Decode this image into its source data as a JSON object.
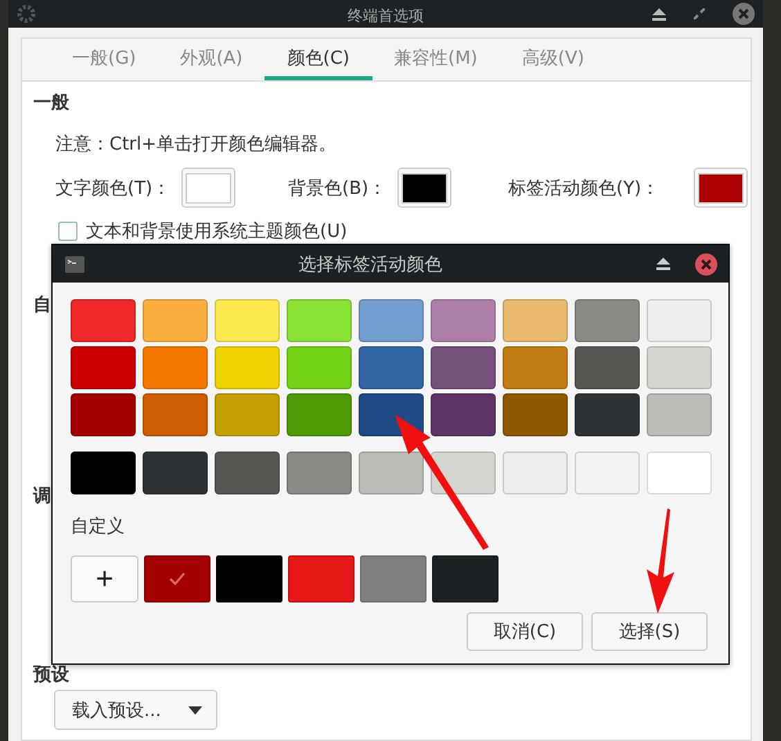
{
  "window": {
    "title": "终端首选项"
  },
  "tabs": [
    {
      "label": "一般(G)",
      "selected": false
    },
    {
      "label": "外观(A)",
      "selected": false
    },
    {
      "label": "颜色(C)",
      "selected": true
    },
    {
      "label": "兼容性(M)",
      "selected": false
    },
    {
      "label": "高级(V)",
      "selected": false
    }
  ],
  "general": {
    "heading": "一般",
    "note": "注意：Ctrl+单击打开颜色编辑器。",
    "color_buttons": [
      {
        "label": "文字颜色(T)：",
        "color": "#ffffff"
      },
      {
        "label": "背景色(B)：",
        "color": "#000000"
      },
      {
        "label": "标签活动颜色(Y)：",
        "color": "#aa0000"
      }
    ],
    "system_theme": {
      "label": "文本和背景使用系统主题颜色(U)",
      "checked": false
    }
  },
  "sections": [
    "自",
    "调"
  ],
  "presets": {
    "heading": "预设",
    "dropdown": "载入预设..."
  },
  "dialog": {
    "title": "选择标签活动颜色",
    "palette": [
      [
        {
          "color": "#ef2929",
          "selected": false
        },
        {
          "color": "#fcaf3e",
          "selected": false
        },
        {
          "color": "#fce94f",
          "selected": false
        },
        {
          "color": "#8ae234",
          "selected": false
        },
        {
          "color": "#729fcf",
          "selected": false
        },
        {
          "color": "#ad7fa8",
          "selected": false
        },
        {
          "color": "#e9b96e",
          "selected": false
        },
        {
          "color": "#888a85",
          "selected": false
        },
        {
          "color": "#eeeeec",
          "selected": false
        }
      ],
      [
        {
          "color": "#cc0000",
          "selected": false
        },
        {
          "color": "#f57900",
          "selected": false
        },
        {
          "color": "#edd400",
          "selected": false
        },
        {
          "color": "#73d216",
          "selected": false
        },
        {
          "color": "#3465a4",
          "selected": false
        },
        {
          "color": "#75507b",
          "selected": false
        },
        {
          "color": "#c17d11",
          "selected": false
        },
        {
          "color": "#555753",
          "selected": false
        },
        {
          "color": "#d3d7cf",
          "selected": false
        }
      ],
      [
        {
          "color": "#a40000",
          "selected": false
        },
        {
          "color": "#ce5c00",
          "selected": false
        },
        {
          "color": "#c4a000",
          "selected": false
        },
        {
          "color": "#4e9a06",
          "selected": false
        },
        {
          "color": "#204a87",
          "selected": false
        },
        {
          "color": "#5c3566",
          "selected": false
        },
        {
          "color": "#8f5902",
          "selected": false
        },
        {
          "color": "#2e3436",
          "selected": false
        },
        {
          "color": "#babdb6",
          "selected": false
        }
      ]
    ],
    "grays": [
      {
        "color": "#000000",
        "selected": false
      },
      {
        "color": "#2e3436",
        "selected": false
      },
      {
        "color": "#555753",
        "selected": false
      },
      {
        "color": "#888a85",
        "selected": false
      },
      {
        "color": "#babdb6",
        "selected": false
      },
      {
        "color": "#d3d7cf",
        "selected": false
      },
      {
        "color": "#ededeb",
        "selected": false
      },
      {
        "color": "#f3f3f3",
        "selected": false
      },
      {
        "color": "#ffffff",
        "selected": false
      }
    ],
    "custom_label": "自定义",
    "add_button": "+",
    "custom": [
      {
        "color": "#a40000",
        "selected": true
      },
      {
        "color": "#000000",
        "selected": false
      },
      {
        "color": "#e51717",
        "selected": false
      },
      {
        "color": "#808080",
        "selected": false
      },
      {
        "color": "#1c2123",
        "selected": false
      }
    ],
    "buttons": [
      "取消(C)",
      "选择(S)"
    ]
  }
}
